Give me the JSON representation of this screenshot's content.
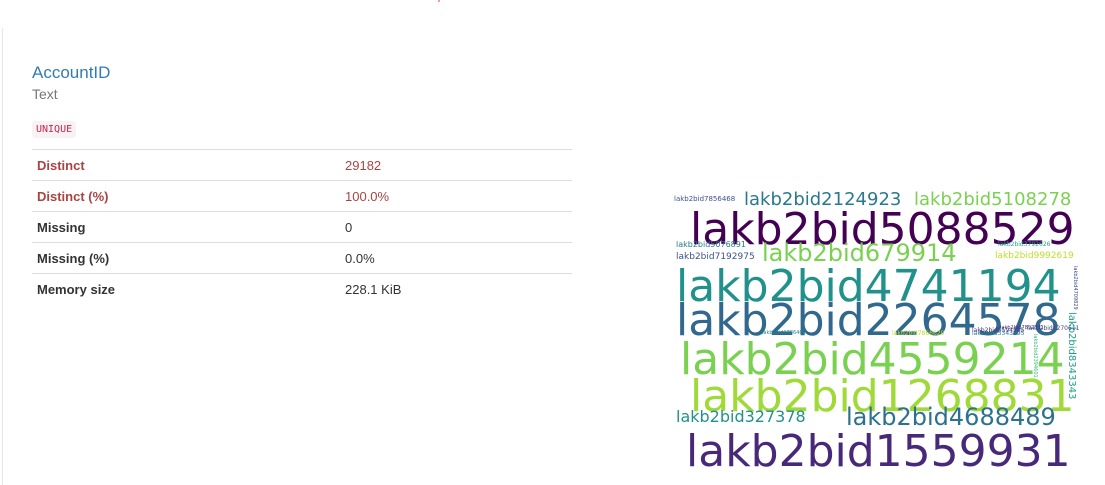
{
  "variable": {
    "name": "AccountID",
    "type": "Text",
    "badge": "UNIQUE"
  },
  "stats": [
    {
      "label": "Distinct",
      "value": "29182",
      "alert": true
    },
    {
      "label": "Distinct (%)",
      "value": "100.0%",
      "alert": true
    },
    {
      "label": "Missing",
      "value": "0",
      "alert": false
    },
    {
      "label": "Missing (%)",
      "value": "0.0%",
      "alert": false
    },
    {
      "label": "Memory size",
      "value": "228.1 KiB",
      "alert": false
    }
  ],
  "wordcloud": {
    "words": [
      {
        "text": "lakb2bid5088529",
        "color": "#440154"
      },
      {
        "text": "lakb2bid2124923",
        "color": "#2a788e"
      },
      {
        "text": "lakb2bid5108278",
        "color": "#7ad151"
      },
      {
        "text": "lakb2bid7856468",
        "color": "#3b528b"
      },
      {
        "text": "lakb2bid679914",
        "color": "#7ad151"
      },
      {
        "text": "lakb2bid5076891",
        "color": "#2a788e"
      },
      {
        "text": "lakb2bid7192975",
        "color": "#3b528b"
      },
      {
        "text": "lakb2bid3792626",
        "color": "#22a884"
      },
      {
        "text": "lakb2bid9992619",
        "color": "#bddf26"
      },
      {
        "text": "lakb2bid4741194",
        "color": "#21918c"
      },
      {
        "text": "lakb2bid2264578",
        "color": "#31688e"
      },
      {
        "text": "lakb2bid4559214",
        "color": "#7ad151"
      },
      {
        "text": "lakb2bid1268831",
        "color": "#a0da39"
      },
      {
        "text": "lakb2bid327378",
        "color": "#21918c"
      },
      {
        "text": "lakb2bid4688489",
        "color": "#2c728e"
      },
      {
        "text": "lakb2bid1559931",
        "color": "#482878"
      },
      {
        "text": "lakb2bid8343343",
        "color": "#1f9e89"
      },
      {
        "text": "lakb2bid1270611",
        "color": "#414487"
      },
      {
        "text": "lakb2bid7892531",
        "color": "#443983"
      },
      {
        "text": "lakb2bid7866629",
        "color": "#b8de29"
      },
      {
        "text": "lakb2bid5343295",
        "color": "#2a788e"
      },
      {
        "text": "lakb2bid1786409",
        "color": "#26828e"
      },
      {
        "text": "lakb2bid6594595",
        "color": "#46327e"
      },
      {
        "text": "lakb2bid2394601",
        "color": "#35b779"
      },
      {
        "text": "lakb2bid4709829",
        "color": "#3e4989"
      }
    ]
  }
}
